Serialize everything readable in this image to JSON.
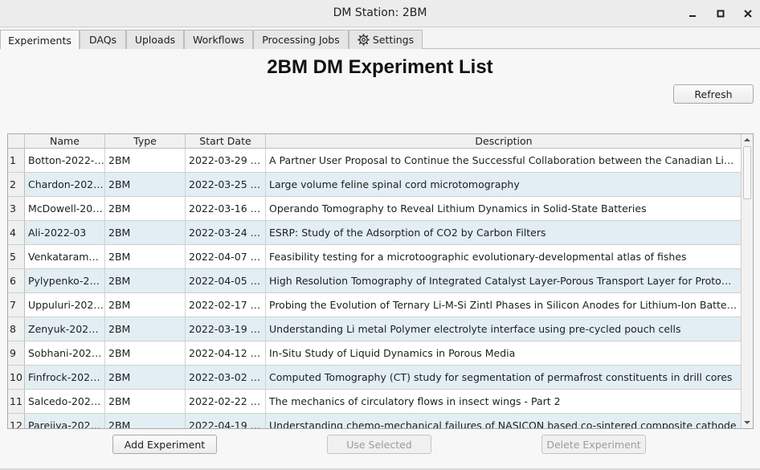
{
  "window": {
    "title": "DM Station: 2BM",
    "minimize_icon": "minimize-icon",
    "maximize_icon": "maximize-icon",
    "close_icon": "close-icon"
  },
  "tabs": [
    {
      "label": "Experiments",
      "active": true
    },
    {
      "label": "DAQs",
      "active": false
    },
    {
      "label": "Uploads",
      "active": false
    },
    {
      "label": "Workflows",
      "active": false
    },
    {
      "label": "Processing Jobs",
      "active": false
    },
    {
      "label": "Settings",
      "active": false,
      "icon": "gear-icon"
    }
  ],
  "main": {
    "heading": "2BM DM Experiment List",
    "refresh_label": "Refresh"
  },
  "table": {
    "columns": [
      "Name",
      "Type",
      "Start Date",
      "Description"
    ],
    "rows": [
      {
        "num": "1",
        "name": "Botton-2022-…",
        "type": "2BM",
        "start": "2022-03-29 …",
        "description": "A Partner User Proposal to Continue the Successful Collaboration between the Canadian Light …"
      },
      {
        "num": "2",
        "name": "Chardon-202…",
        "type": "2BM",
        "start": "2022-03-25 …",
        "description": "Large volume feline spinal cord microtomography"
      },
      {
        "num": "3",
        "name": "McDowell-20…",
        "type": "2BM",
        "start": "2022-03-16 …",
        "description": "Operando Tomography to Reveal Lithium Dynamics in Solid-State Batteries"
      },
      {
        "num": "4",
        "name": "Ali-2022-03",
        "type": "2BM",
        "start": "2022-03-24 …",
        "description": "ESRP: Study of the Adsorption of CO2 by Carbon Filters"
      },
      {
        "num": "5",
        "name": "Venkatarama…",
        "type": "2BM",
        "start": "2022-04-07 …",
        "description": "Feasibility testing for a microtoographic evolutionary-developmental atlas  of fishes"
      },
      {
        "num": "6",
        "name": "Pylypenko-2…",
        "type": "2BM",
        "start": "2022-04-05 …",
        "description": "High Resolution Tomography of Integrated Catalyst Layer-Porous Transport Layer for Proton …"
      },
      {
        "num": "7",
        "name": "Uppuluri-202…",
        "type": "2BM",
        "start": "2022-02-17 …",
        "description": "Probing the Evolution of Ternary Li-M-Si Zintl Phases in Silicon Anodes for Lithium-Ion Batteries…"
      },
      {
        "num": "8",
        "name": "Zenyuk-2022…",
        "type": "2BM",
        "start": "2022-03-19 …",
        "description": "Understanding Li metal Polymer electrolyte interface using pre-cycled pouch cells"
      },
      {
        "num": "9",
        "name": "Sobhani-202…",
        "type": "2BM",
        "start": "2022-04-12 …",
        "description": "In-Situ Study of Liquid Dynamics in Porous Media"
      },
      {
        "num": "10",
        "name": "Finfrock-202…",
        "type": "2BM",
        "start": "2022-03-02 …",
        "description": "Computed Tomography (CT) study for segmentation of permafrost constituents in drill cores"
      },
      {
        "num": "11",
        "name": "Salcedo-202…",
        "type": "2BM",
        "start": "2022-02-22 …",
        "description": "The mechanics of circulatory flows in insect wings - Part 2"
      },
      {
        "num": "12",
        "name": "Pareijya-202…",
        "type": "2BM",
        "start": "2022-04-19 …",
        "description": "Understanding chemo-mechanical failures of NASICON based co-sintered composite cathode"
      }
    ]
  },
  "actions": {
    "add_label": "Add Experiment",
    "use_label": "Use Selected",
    "delete_label": "Delete Experiment"
  }
}
